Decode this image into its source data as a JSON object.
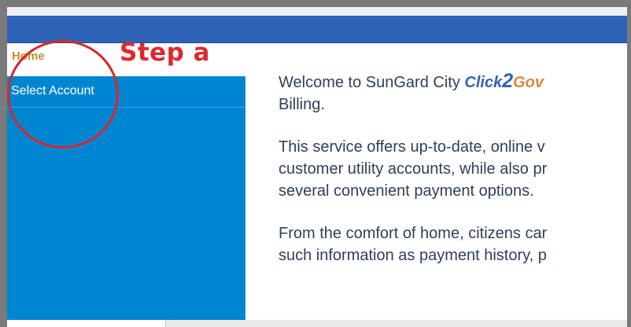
{
  "nav": {
    "home_label": "Home",
    "sidebar_items": [
      {
        "label": "Select Account"
      }
    ]
  },
  "annotation": {
    "step_label": "Step a"
  },
  "content": {
    "p1_line1_prefix": "Welcome to SunGard City ",
    "brand_click": "Click",
    "brand_two": "2",
    "brand_gov": "Gov",
    "p1_line2": "Billing.",
    "p2_line1": "This service offers up-to-date, online v",
    "p2_line2": "customer utility accounts, while also pr",
    "p2_line3": "several convenient payment options.",
    "p3_line1": "From the comfort of home, citizens car",
    "p3_line2": "such information as payment history, p"
  },
  "colors": {
    "header": "#2f63b8",
    "sidebar": "#0086d1",
    "home_link": "#c88b2e",
    "annotation_red": "#e0272b",
    "body_text": "#2e3f5c"
  }
}
